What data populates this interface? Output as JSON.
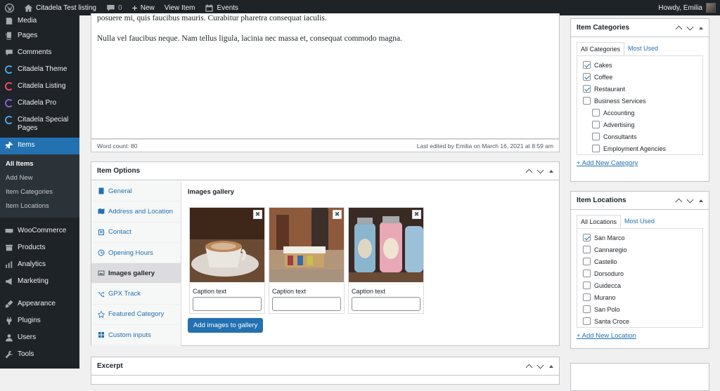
{
  "adminbar": {
    "site_name": "Citadela Test listing",
    "comments": "0",
    "new": "New",
    "view_item": "View Item",
    "events": "Events",
    "howdy": "Howdy, Emilia"
  },
  "sidebar": {
    "items_top": [
      {
        "label": "Media",
        "icon": "media-icon"
      },
      {
        "label": "Pages",
        "icon": "pages-icon"
      },
      {
        "label": "Comments",
        "icon": "comments-icon"
      },
      {
        "label": "Citadela Theme",
        "icon": "citadela-logo-icon"
      },
      {
        "label": "Citadela Listing",
        "icon": "citadela-logo-icon"
      },
      {
        "label": "Citadela Pro",
        "icon": "citadela-logo-icon"
      },
      {
        "label": "Citadela Special Pages",
        "icon": "citadela-logo-icon"
      }
    ],
    "active": "Items",
    "submenu": [
      "All Items",
      "Add New",
      "Item Categories",
      "Item Locations"
    ],
    "items_bottom": [
      {
        "label": "WooCommerce"
      },
      {
        "label": "Products"
      },
      {
        "label": "Analytics"
      },
      {
        "label": "Marketing"
      },
      {
        "label": "Appearance"
      },
      {
        "label": "Plugins"
      },
      {
        "label": "Users"
      },
      {
        "label": "Tools"
      }
    ]
  },
  "editor": {
    "para1": "posuere mi, quis faucibus mauris. Curabitur pharetra consequat iaculis.",
    "para2": "Nulla vel faucibus neque. Nam tellus ligula, lacinia nec massa et, consequat commodo magna.",
    "word_count": "Word count: 80",
    "last_edited": "Last edited by Emilia on March 16, 2021 at 8:59 am"
  },
  "item_options": {
    "title": "Item Options",
    "tabs": [
      "General",
      "Address and Location",
      "Contact",
      "Opening Hours",
      "Images gallery",
      "GPX Track",
      "Featured Category",
      "Custom inputs"
    ],
    "selected_tab": "Images gallery",
    "gallery_title": "Images gallery",
    "caption_label": "Caption text",
    "add_button": "Add images to gallery",
    "images": [
      "coffee-cup-photo",
      "market-stall-photo",
      "candy-jars-photo"
    ]
  },
  "excerpt": {
    "title": "Excerpt"
  },
  "categories": {
    "title": "Item Categories",
    "tab_all": "All Categories",
    "tab_most": "Most Used",
    "list": [
      {
        "label": "Cakes",
        "checked": true
      },
      {
        "label": "Coffee",
        "checked": true
      },
      {
        "label": "Restaurant",
        "checked": true
      },
      {
        "label": "Business Services",
        "checked": false
      },
      {
        "label": "Accounting",
        "checked": false
      },
      {
        "label": "Advertising",
        "checked": false
      },
      {
        "label": "Consultants",
        "checked": false
      },
      {
        "label": "Employment Agencies",
        "checked": false
      }
    ],
    "add_link": "+ Add New Category"
  },
  "locations": {
    "title": "Item Locations",
    "tab_all": "All Locations",
    "tab_most": "Most Used",
    "list": [
      {
        "label": "San Marco",
        "checked": true
      },
      {
        "label": "Cannaregio",
        "checked": false
      },
      {
        "label": "Castello",
        "checked": false
      },
      {
        "label": "Dorsoduro",
        "checked": false
      },
      {
        "label": "Guidecca",
        "checked": false
      },
      {
        "label": "Murano",
        "checked": false
      },
      {
        "label": "San Polo",
        "checked": false
      },
      {
        "label": "Santa Croce",
        "checked": false
      }
    ],
    "add_link": "+ Add New Location"
  }
}
